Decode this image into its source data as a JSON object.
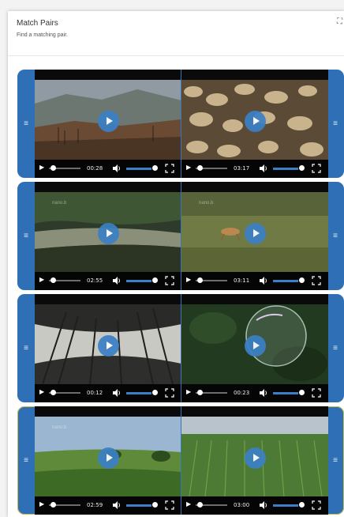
{
  "app": {
    "title": "Match Pairs",
    "subtitle": "Find a matching pair."
  },
  "icons": {
    "drag_handle": "≡",
    "expand": "expand-icon",
    "play": "play-icon",
    "volume": "volume-icon",
    "fullscreen": "fullscreen-icon"
  },
  "colors": {
    "accent": "#2f6fb5",
    "play_button": "#3b80c6",
    "selection_outline": "#c9bf4a"
  },
  "pairs": [
    {
      "selected": false,
      "left": {
        "time": "00:28",
        "watermark": ""
      },
      "right": {
        "time": "03:17",
        "watermark": ""
      }
    },
    {
      "selected": false,
      "left": {
        "time": "02:55",
        "watermark": "nano.b"
      },
      "right": {
        "time": "03:11",
        "watermark": "nano.b"
      }
    },
    {
      "selected": false,
      "left": {
        "time": "00:12",
        "watermark": ""
      },
      "right": {
        "time": "00:23",
        "watermark": ""
      }
    },
    {
      "selected": true,
      "left": {
        "time": "02:59",
        "watermark": "nano.b"
      },
      "right": {
        "time": "03:00",
        "watermark": ""
      }
    }
  ]
}
